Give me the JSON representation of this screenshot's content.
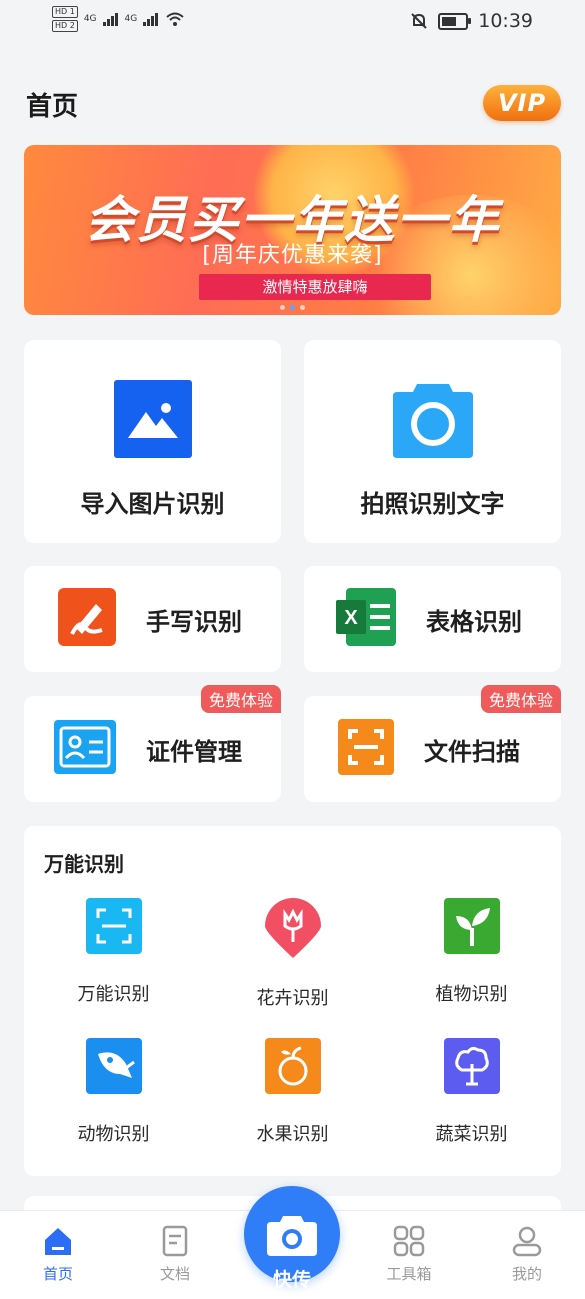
{
  "statusbar": {
    "hd1": "HD 1",
    "hd2": "HD 2",
    "net1": "4G",
    "net2": "4G",
    "time": "10:39"
  },
  "header": {
    "title": "首页",
    "vip": "VIP"
  },
  "banner": {
    "headline": "会员买一年送一年",
    "subtitle": "[周年庆优惠来袭]",
    "ribbon": "激情特惠放肆嗨",
    "active_dot": 1,
    "dot_count": 3
  },
  "features": {
    "import_image": "导入图片识别",
    "photo_text": "拍照识别文字",
    "handwriting": "手写识别",
    "table": "表格识别",
    "id_manage": "证件管理",
    "file_scan": "文件扫描",
    "free_trial_tag": "免费体验"
  },
  "universal": {
    "title": "万能识别",
    "items": [
      {
        "label": "万能识别",
        "icon": "scan-frame-icon",
        "color": "#1ab8f3"
      },
      {
        "label": "花卉识别",
        "icon": "flower-icon",
        "color": "#f15063"
      },
      {
        "label": "植物识别",
        "icon": "plant-icon",
        "color": "#3aa932"
      },
      {
        "label": "动物识别",
        "icon": "fish-icon",
        "color": "#1a8ff0"
      },
      {
        "label": "水果识别",
        "icon": "apple-icon",
        "color": "#f5891a"
      },
      {
        "label": "蔬菜识别",
        "icon": "vegetable-icon",
        "color": "#5d5cf0"
      }
    ]
  },
  "tabbar": {
    "home": "首页",
    "docs": "文档",
    "capture": "快传",
    "tools": "工具箱",
    "me": "我的",
    "active_color": "#2b6ef5"
  }
}
